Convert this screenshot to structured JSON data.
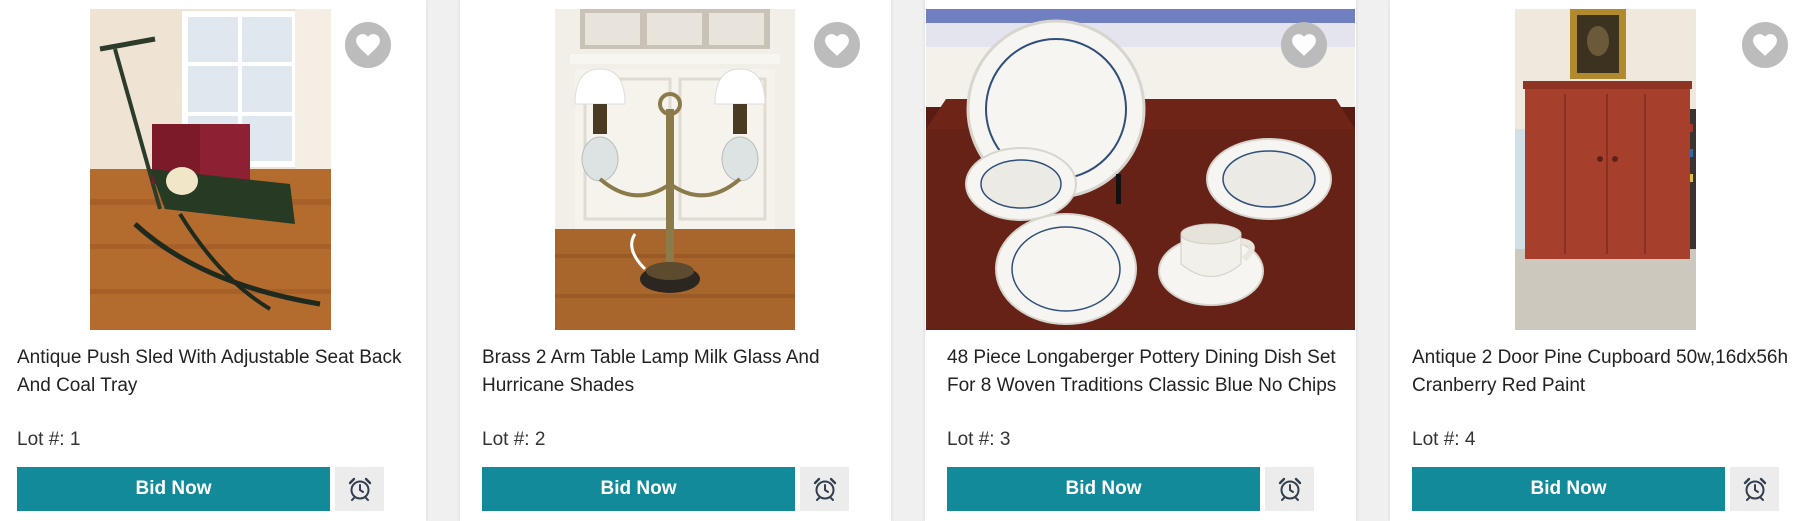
{
  "lots": [
    {
      "title": "Antique Push Sled With Adjustable Seat Back And Coal Tray",
      "lot_label": "Lot #: 1",
      "bid_label": "Bid Now"
    },
    {
      "title": "Brass 2 Arm Table Lamp Milk Glass And Hurricane Shades",
      "lot_label": "Lot #: 2",
      "bid_label": "Bid Now"
    },
    {
      "title": "48 Piece Longaberger Pottery Dining Dish Set For 8 Woven Traditions Classic Blue No Chips",
      "lot_label": "Lot #: 3",
      "bid_label": "Bid Now"
    },
    {
      "title": "Antique 2 Door Pine Cupboard 50w,16dx56h Cranberry Red Paint",
      "lot_label": "Lot #: 4",
      "bid_label": "Bid Now"
    }
  ],
  "icons": {
    "favorite": "heart-icon",
    "reminder": "alarm-clock-icon"
  },
  "colors": {
    "accent": "#138a99",
    "favorite_bg": "#b9b9b9",
    "alarm_bg": "#ececec",
    "title_text": "#222222"
  }
}
